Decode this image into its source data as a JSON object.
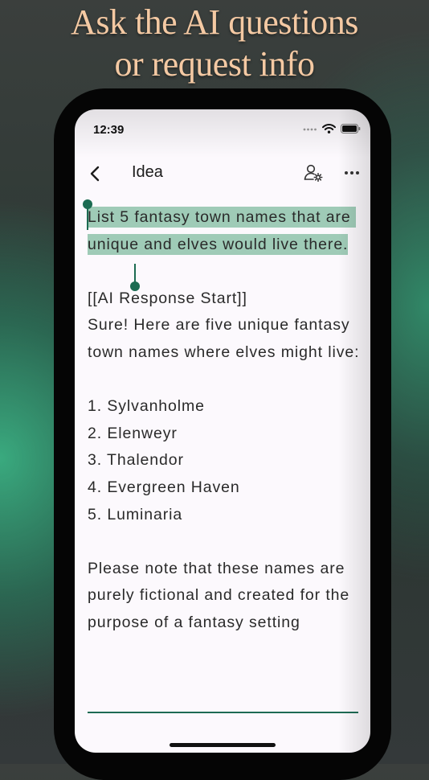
{
  "headline": {
    "line1": "Ask the AI questions",
    "line2": "or request info"
  },
  "status_bar": {
    "time": "12:39",
    "icons": [
      "signal-dots-icon",
      "wifi-icon",
      "battery-icon"
    ]
  },
  "app_bar": {
    "title": "Idea",
    "icons": [
      "back-chevron-icon",
      "person-settings-icon",
      "more-horizontal-icon"
    ]
  },
  "editor": {
    "selected_prompt": "List 5 fantasy town names that are unique and elves would live there.",
    "marker_start": "[[AI Response Start]]",
    "response_intro": "Sure! Here are five unique fantasy town names where elves might live:",
    "list_items": [
      "1. Sylvanholme",
      "2. Elenweyr",
      "3. Thalendor",
      "4. Evergreen Haven",
      "5. Luminaria"
    ],
    "note": "Please note that these names are purely fictional and created for the purpose of a fantasy setting"
  },
  "colors": {
    "selection": "#9fcbb7",
    "accent": "#1c6b52",
    "headline": "#f4c9a3"
  }
}
